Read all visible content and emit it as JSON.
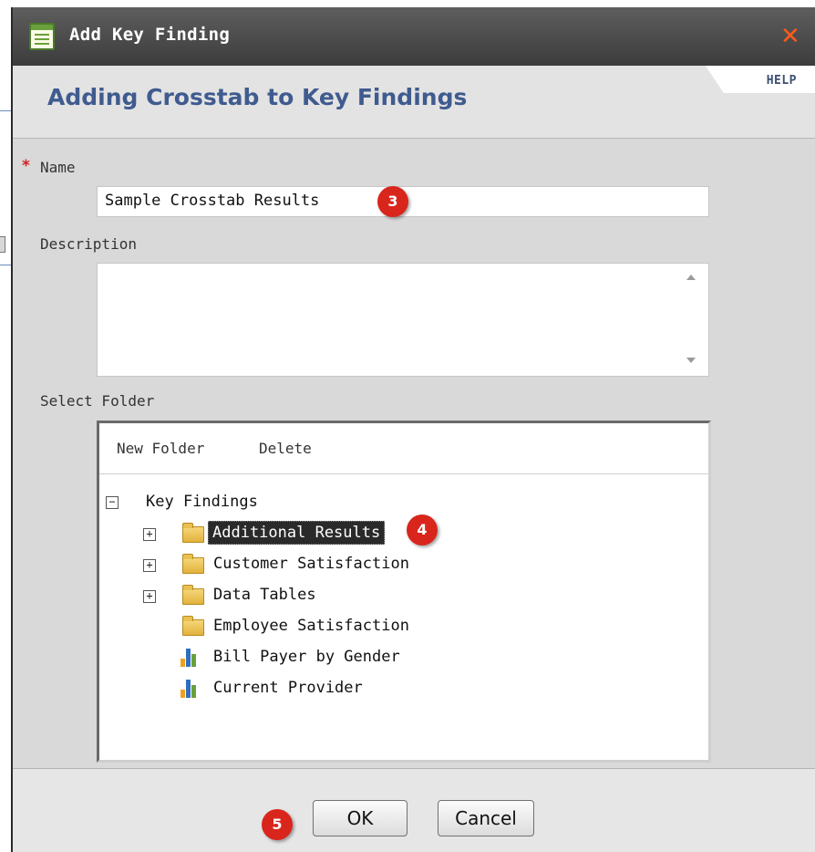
{
  "dialog": {
    "title": "Add Key Finding",
    "close_glyph": "✕",
    "subtitle": "Adding Crosstab to Key Findings",
    "help_label": "HELP"
  },
  "form": {
    "required_marker": "*",
    "name_label": "Name",
    "name_value": "Sample Crosstab Results",
    "description_label": "Description",
    "description_value": "",
    "select_folder_label": "Select Folder"
  },
  "folder_panel": {
    "toolbar": {
      "new_folder": "New Folder",
      "delete": "Delete"
    },
    "tree": {
      "root": {
        "label": "Key Findings",
        "toggle": "−"
      },
      "items": [
        {
          "label": "Additional Results",
          "type": "folder",
          "toggle": "+",
          "selected": true
        },
        {
          "label": "Customer Satisfaction",
          "type": "folder",
          "toggle": "+"
        },
        {
          "label": "Data Tables",
          "type": "folder",
          "toggle": "+"
        },
        {
          "label": "Employee Satisfaction",
          "type": "folder"
        },
        {
          "label": "Bill Payer by Gender",
          "type": "chart"
        },
        {
          "label": "Current Provider",
          "type": "chart"
        }
      ]
    }
  },
  "buttons": {
    "ok": "OK",
    "cancel": "Cancel"
  },
  "callouts": {
    "name": "3",
    "folder": "4",
    "ok": "5"
  },
  "colors": {
    "title_accent": "#3f5b8f",
    "close": "#ff5a1a",
    "callout": "#d9261c",
    "required": "#d62020"
  }
}
